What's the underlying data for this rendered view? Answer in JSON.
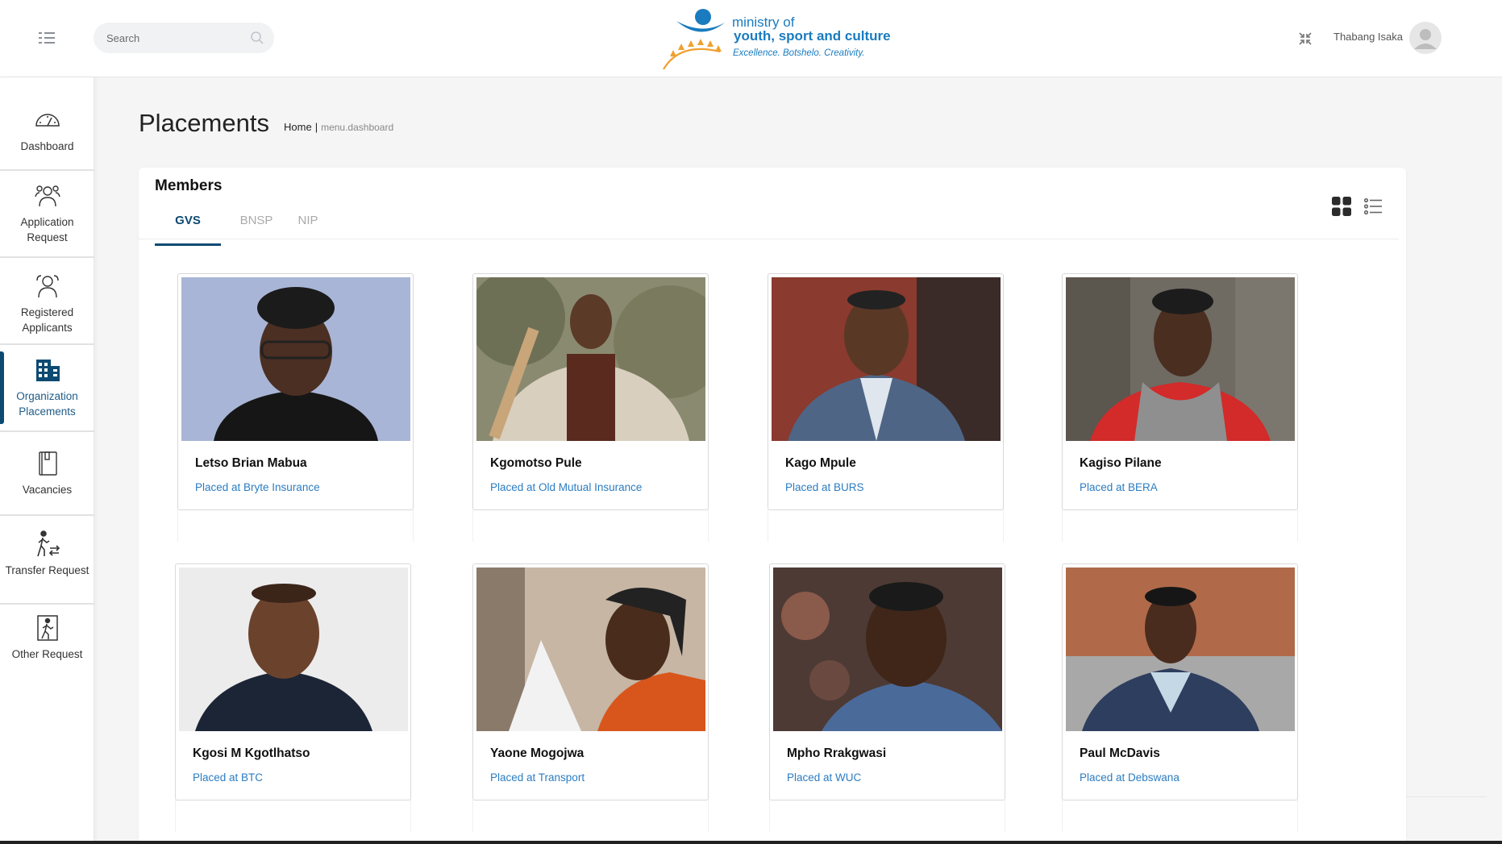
{
  "header": {
    "search_placeholder": "Search",
    "logo": {
      "line1": "ministry of",
      "line2": "youth, sport and culture",
      "line3": "Excellence. Botshelo. Creativity."
    },
    "user_name": "Thabang Isaka"
  },
  "sidebar": {
    "items": [
      {
        "label": "Dashboard",
        "icon": "gauge-icon"
      },
      {
        "label": "Application Request",
        "icon": "people-icon"
      },
      {
        "label": "Registered Applicants",
        "icon": "person-icon"
      },
      {
        "label": "Organization Placements",
        "icon": "building-icon",
        "active": true
      },
      {
        "label": "Vacancies",
        "icon": "book-icon"
      },
      {
        "label": "Transfer Request",
        "icon": "walking-transfer-icon"
      },
      {
        "label": "Other Request",
        "icon": "exit-door-icon"
      }
    ]
  },
  "page": {
    "title": "Placements",
    "breadcrumb": {
      "home": "Home",
      "separator": "|",
      "current": "menu.dashboard"
    }
  },
  "members": {
    "title": "Members",
    "tabs": [
      {
        "label": "GVS",
        "active": true
      },
      {
        "label": "BNSP",
        "active": false
      },
      {
        "label": "NIP",
        "active": false
      }
    ],
    "view_mode": "grid",
    "cards": [
      {
        "name": "Letso Brian Mabua",
        "placed": "Placed at Bryte Insurance"
      },
      {
        "name": "Kgomotso Pule",
        "placed": "Placed at Old Mutual Insurance"
      },
      {
        "name": "Kago Mpule",
        "placed": "Placed at BURS"
      },
      {
        "name": "Kagiso Pilane",
        "placed": "Placed at BERA"
      },
      {
        "name": "Kgosi M Kgotlhatso",
        "placed": "Placed at BTC"
      },
      {
        "name": "Yaone Mogojwa",
        "placed": "Placed at Transport"
      },
      {
        "name": "Mpho Rrakgwasi",
        "placed": "Placed at WUC"
      },
      {
        "name": "Paul McDavis",
        "placed": "Placed at Debswana"
      }
    ]
  },
  "colors": {
    "accent": "#0d4a72",
    "link": "#2b7cc1",
    "brand_blue": "#1a7bbf",
    "brand_orange": "#f0a030"
  }
}
